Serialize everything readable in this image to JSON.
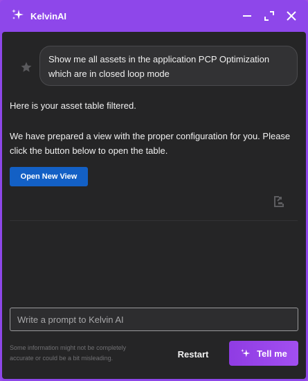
{
  "window": {
    "title": "KelvinAI"
  },
  "chat": {
    "user_message": "Show me all assets in the application PCP Optimization which are in closed loop mode",
    "assistant_line1": "Here is your asset table filtered.",
    "assistant_line2": "We have prepared a view with the proper configuration for you. Please click the button below to open the table.",
    "open_view_label": "Open New View"
  },
  "composer": {
    "placeholder": "Write a prompt to Kelvin AI",
    "disclaimer": "Some information might not be completely accurate or could be a bit misleading.",
    "restart_label": "Restart",
    "submit_label": "Tell me"
  },
  "icons": {
    "title": "sparkle-icon",
    "minimize": "minimize-icon",
    "expand": "expand-icon",
    "close": "close-icon",
    "user": "star-icon",
    "export": "export-icon",
    "submit": "sparkle-icon"
  },
  "colors": {
    "accent": "#8e47ea",
    "button_primary": "#1360c5",
    "panel_bg": "#252526"
  }
}
